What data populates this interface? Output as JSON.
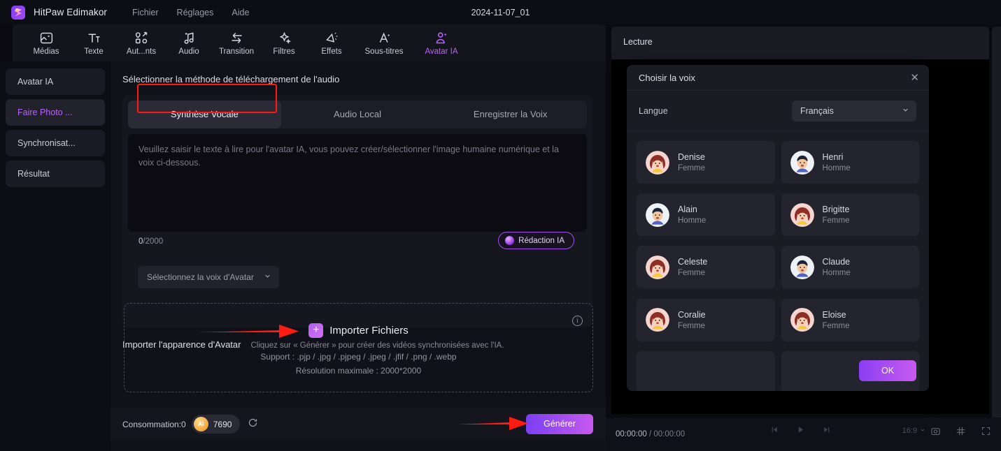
{
  "titlebar": {
    "app_name": "HitPaw Edimakor",
    "menus": [
      "Fichier",
      "Réglages",
      "Aide"
    ],
    "project_title": "2024-11-07_01",
    "logo_icon": "hitpaw-logo-icon"
  },
  "toolbar": {
    "items": [
      {
        "label": "Médias",
        "icon": "media-icon",
        "active": false
      },
      {
        "label": "Texte",
        "icon": "text-icon",
        "active": false
      },
      {
        "label": "Aut...nts",
        "icon": "elements-icon",
        "active": false
      },
      {
        "label": "Audio",
        "icon": "audio-icon",
        "active": false
      },
      {
        "label": "Transition",
        "icon": "transition-icon",
        "active": false
      },
      {
        "label": "Filtres",
        "icon": "filters-icon",
        "active": false
      },
      {
        "label": "Effets",
        "icon": "effects-icon",
        "active": false
      },
      {
        "label": "Sous-titres",
        "icon": "subtitles-icon",
        "active": false
      },
      {
        "label": "Avatar IA",
        "icon": "ai-avatar-icon",
        "active": true
      }
    ]
  },
  "sidebar": {
    "items": [
      {
        "label": "Avatar IA",
        "active": false
      },
      {
        "label": "Faire Photo ...",
        "active": true
      },
      {
        "label": "Synchronisat...",
        "active": false
      },
      {
        "label": "Résultat",
        "active": false
      }
    ]
  },
  "main": {
    "title": "Sélectionner la méthode de téléchargement de l'audio",
    "tabs": [
      {
        "label": "Synthèse Vocale",
        "active": true
      },
      {
        "label": "Audio Local",
        "active": false
      },
      {
        "label": "Enregistrer la Voix",
        "active": false
      }
    ],
    "textarea_placeholder": "Veuillez saisir le texte à lire pour l'avatar IA, vous pouvez créer/sélectionner l'image humaine numérique et la voix ci-dessous.",
    "textarea_value": "",
    "counter_current": "0",
    "counter_max": "/2000",
    "redaction_label": "Rédaction IA",
    "voice_select_label": "Sélectionnez la voix d'Avatar",
    "import_heading": "Importer l'apparence d'Avatar",
    "import_hint": "Cliquez sur « Générer » pour créer des vidéos synchronisées avec l'IA.",
    "import_button_label": "Importer Fichiers",
    "support_line1": "Support : .pjp / .jpg / .pjpeg / .jpeg / .jfif / .png / .webp",
    "support_line2": "Résolution maximale : 2000*2000",
    "info_icon": "info-icon"
  },
  "bottombar": {
    "consumption_label": "Consommation:0",
    "coin_badge": "AI",
    "coin_value": "7690",
    "refresh_icon": "refresh-icon",
    "generate_label": "Générer"
  },
  "preview": {
    "header_label": "Lecture",
    "current_time": "00:00:00",
    "time_separator": " / ",
    "total_time": "00:00:00",
    "aspect_ratio": "16:9",
    "controls": [
      "prev-frame-icon",
      "play-icon",
      "next-frame-icon"
    ],
    "right_icons": [
      "snapshot-icon",
      "grid-icon",
      "fullscreen-icon"
    ]
  },
  "dialog": {
    "title": "Choisir la voix",
    "close_icon": "close-icon",
    "language_label": "Langue",
    "language_value": "Français",
    "ok_label": "OK",
    "voices": [
      {
        "name": "Denise",
        "gender": "Femme",
        "avatar": "female-red-hair-avatar"
      },
      {
        "name": "Henri",
        "gender": "Homme",
        "avatar": "male-dark-hair-avatar"
      },
      {
        "name": "Alain",
        "gender": "Homme",
        "avatar": "male-dark-hair-avatar"
      },
      {
        "name": "Brigitte",
        "gender": "Femme",
        "avatar": "female-red-hair-avatar"
      },
      {
        "name": "Celeste",
        "gender": "Femme",
        "avatar": "female-red-hair-avatar"
      },
      {
        "name": "Claude",
        "gender": "Homme",
        "avatar": "male-dark-hair-avatar"
      },
      {
        "name": "Coralie",
        "gender": "Femme",
        "avatar": "female-red-hair-avatar"
      },
      {
        "name": "Eloise",
        "gender": "Femme",
        "avatar": "female-red-hair-avatar"
      },
      {
        "name": "",
        "gender": "",
        "avatar": "partial-avatar"
      },
      {
        "name": "",
        "gender": "",
        "avatar": "partial-avatar"
      }
    ]
  },
  "annotations": {
    "tab_highlight_color": "#ff1a12",
    "arrow_color": "#ff1a12",
    "accent_purple": "#b764f5",
    "generate_gradient_from": "#7b3ff2",
    "generate_gradient_to": "#c659ef"
  }
}
